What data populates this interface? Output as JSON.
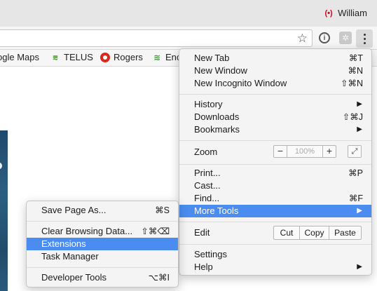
{
  "window": {
    "profile_name": "William"
  },
  "bookmarks": [
    {
      "label": "ogle Maps",
      "icon": "maps-icon"
    },
    {
      "label": "TELUS",
      "icon": "telus-icon"
    },
    {
      "label": "Rogers",
      "icon": "rogers-icon"
    },
    {
      "label": "Enc",
      "icon": "enc-icon"
    }
  ],
  "main_menu": {
    "new_tab": {
      "label": "New Tab",
      "shortcut": "⌘T"
    },
    "new_window": {
      "label": "New Window",
      "shortcut": "⌘N"
    },
    "new_incognito": {
      "label": "New Incognito Window",
      "shortcut": "⇧⌘N"
    },
    "history": {
      "label": "History",
      "arrow": "▶"
    },
    "downloads": {
      "label": "Downloads",
      "shortcut": "⇧⌘J"
    },
    "bookmarks": {
      "label": "Bookmarks",
      "arrow": "▶"
    },
    "zoom": {
      "label": "Zoom",
      "minus": "−",
      "value": "100%",
      "plus": "+",
      "fullscreen": "⤢"
    },
    "print": {
      "label": "Print...",
      "shortcut": "⌘P"
    },
    "cast": {
      "label": "Cast..."
    },
    "find": {
      "label": "Find...",
      "shortcut": "⌘F"
    },
    "more_tools": {
      "label": "More Tools",
      "arrow": "▶"
    },
    "edit": {
      "label": "Edit",
      "cut": "Cut",
      "copy": "Copy",
      "paste": "Paste"
    },
    "settings": {
      "label": "Settings"
    },
    "help": {
      "label": "Help",
      "arrow": "▶"
    }
  },
  "more_tools_menu": {
    "save_page": {
      "label": "Save Page As...",
      "shortcut": "⌘S"
    },
    "clear_browsing": {
      "label": "Clear Browsing Data...",
      "shortcut": "⇧⌘⌫"
    },
    "extensions": {
      "label": "Extensions"
    },
    "task_manager": {
      "label": "Task Manager"
    },
    "developer_tools": {
      "label": "Developer Tools",
      "shortcut": "⌥⌘I"
    }
  },
  "colors": {
    "highlight": "#4a8cef",
    "menu_bg": "#f4f4f4",
    "profile_accent": "#d0021b"
  }
}
